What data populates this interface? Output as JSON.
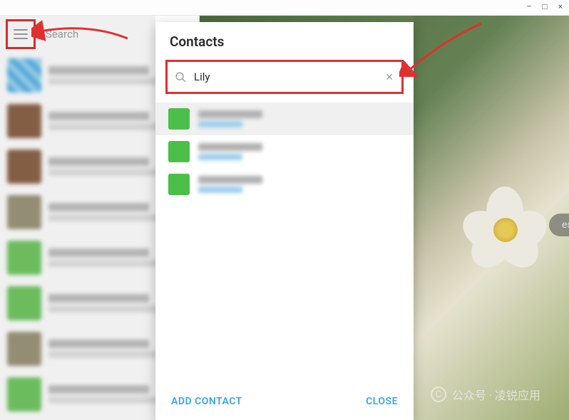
{
  "window": {
    "minimize_label": "−",
    "maximize_label": "□",
    "close_label": "×"
  },
  "sidebar": {
    "search_placeholder": "Search"
  },
  "content": {
    "start_chip": "essaging"
  },
  "modal": {
    "title": "Contacts",
    "search_value": "Lily",
    "clear_label": "×",
    "add_contact_label": "ADD CONTACT",
    "close_label": "CLOSE"
  },
  "watermark": {
    "badge": "C",
    "text": "公众号 · 凌锐应用"
  }
}
